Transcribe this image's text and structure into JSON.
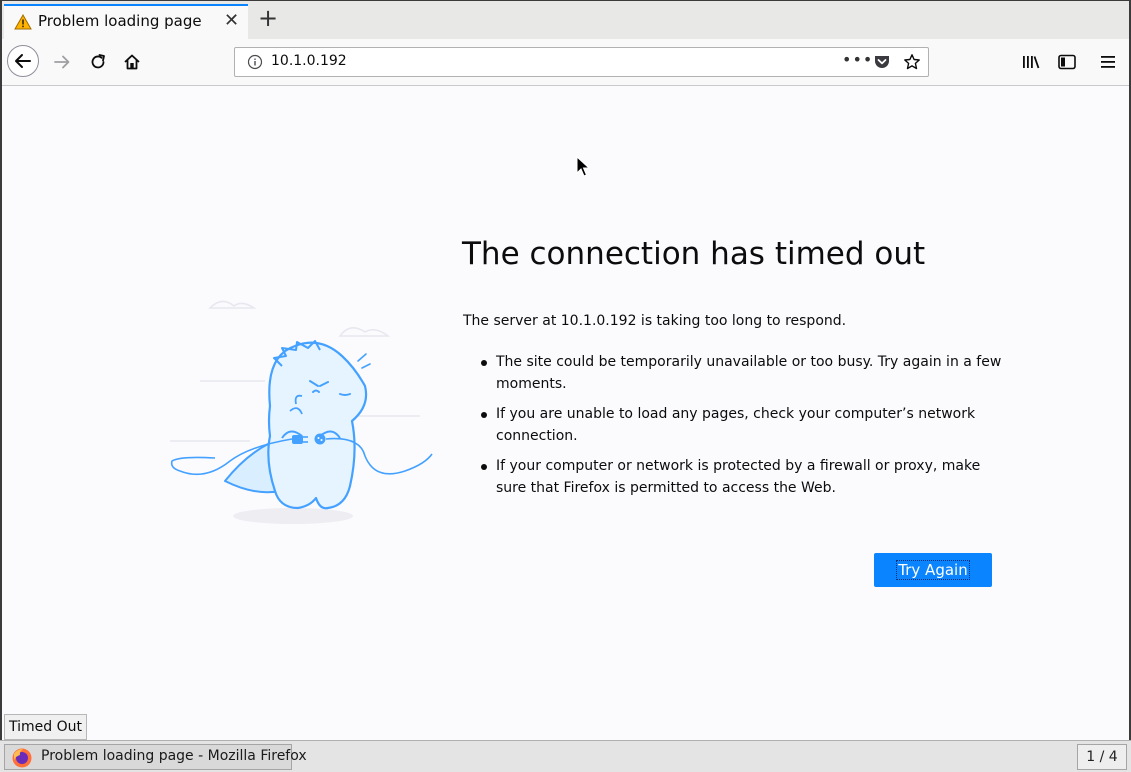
{
  "browser": {
    "tab": {
      "title": "Problem loading page"
    },
    "url": "10.1.0.192",
    "colors": {
      "accent": "#0a84ff",
      "warning": "#ffb400"
    }
  },
  "error": {
    "title": "The connection has timed out",
    "description": "The server at 10.1.0.192 is taking too long to respond.",
    "tips": [
      "The site could be temporarily unavailable or too busy. Try again in a few moments.",
      "If you are unable to load any pages, check your computer’s network connection.",
      "If your computer or network is protected by a firewall or proxy, make sure that Firefox is permitted to access the Web."
    ],
    "button_label": "Try Again"
  },
  "status": {
    "text": "Timed Out"
  },
  "taskbar": {
    "window_title": "Problem loading page - Mozilla Firefox",
    "workspace": "1 / 4"
  }
}
